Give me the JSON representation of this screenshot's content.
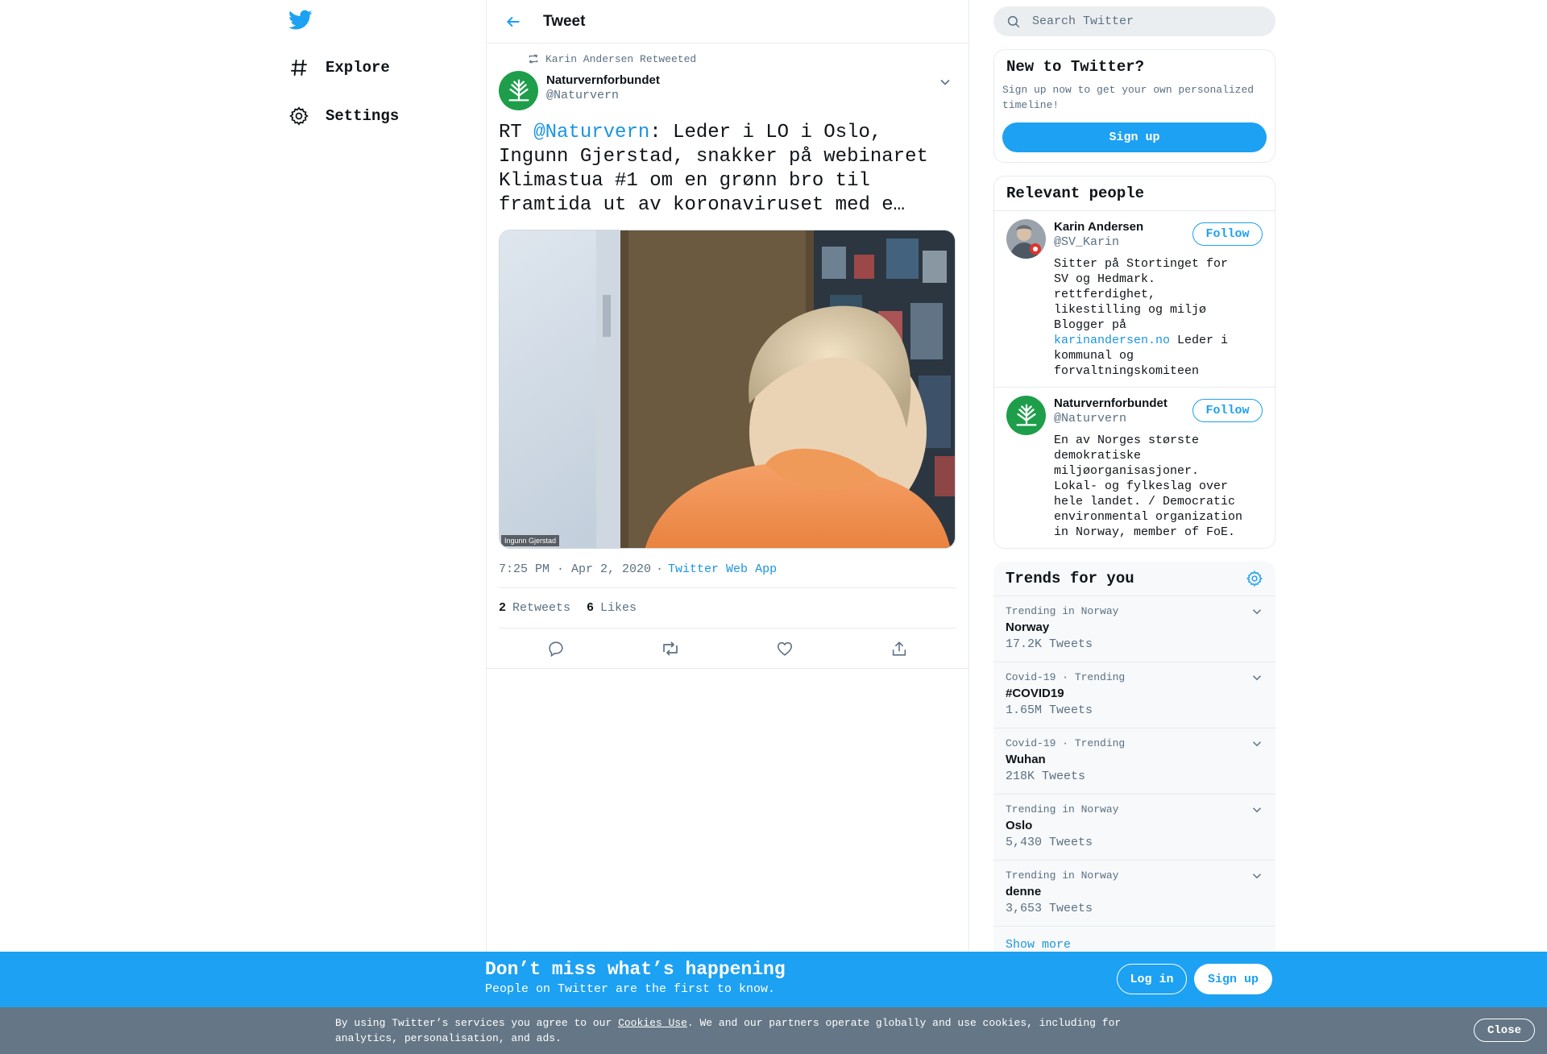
{
  "nav": {
    "logo_icon": "twitter-bird-icon",
    "items": [
      {
        "label": "Explore",
        "icon": "hashtag-icon"
      },
      {
        "label": "Settings",
        "icon": "gear-icon"
      }
    ]
  },
  "header": {
    "title": "Tweet",
    "back_icon": "arrow-left-icon"
  },
  "tweet": {
    "retweeted_by": "Karin Andersen Retweeted",
    "author_name": "Naturvernforbundet",
    "author_handle": "@Naturvern",
    "text_prefix": "RT ",
    "mention": "@Naturvern",
    "text_rest": ": Leder i LO i Oslo, Ingunn Gjerstad, snakker på webinaret Klimastua #1 om en grønn bro til framtida ut av koronaviruset med e…",
    "media_caption": "Ingunn Gjerstad",
    "timestamp": "7:25 PM · Apr 2, 2020",
    "separator": "·",
    "source": "Twitter Web App",
    "retweets_count": "2",
    "retweets_label": "Retweets",
    "likes_count": "6",
    "likes_label": "Likes"
  },
  "search": {
    "placeholder": "Search Twitter"
  },
  "new_to_twitter": {
    "title": "New to Twitter?",
    "subtitle": "Sign up now to get your own personalized timeline!",
    "signup_label": "Sign up"
  },
  "relevant": {
    "title": "Relevant people",
    "people": [
      {
        "name": "Karin Andersen",
        "handle": "@SV_Karin",
        "follow_label": "Follow",
        "bio_before": "Sitter på Stortinget for SV og Hedmark. rettferdighet, likestilling og miljø Blogger på ",
        "bio_link": "karinandersen.no",
        "bio_after": " Leder i kommunal og forvaltningskomiteen"
      },
      {
        "name": "Naturvernforbundet",
        "handle": "@Naturvern",
        "follow_label": "Follow",
        "bio_before": "En av Norges største demokratiske miljøorganisasjoner. Lokal- og fylkeslag over hele landet. / Democratic environmental organization in Norway, member of FoE.",
        "bio_link": "",
        "bio_after": ""
      }
    ]
  },
  "trends": {
    "title": "Trends for you",
    "items": [
      {
        "context": "Trending in Norway",
        "name": "Norway",
        "count": "17.2K Tweets"
      },
      {
        "context": "Covid-19 · Trending",
        "name": "#COVID19",
        "count": "1.65M Tweets"
      },
      {
        "context": "Covid-19 · Trending",
        "name": "Wuhan",
        "count": "218K Tweets"
      },
      {
        "context": "Trending in Norway",
        "name": "Oslo",
        "count": "5,430 Tweets"
      },
      {
        "context": "Trending in Norway",
        "name": "denne",
        "count": "3,653 Tweets"
      }
    ],
    "show_more": "Show more"
  },
  "bottom_bar": {
    "title": "Don’t miss what’s happening",
    "subtitle": "People on Twitter are the first to know.",
    "login_label": "Log in",
    "signup_label": "Sign up"
  },
  "cookie_bar": {
    "text_before": "By using Twitter’s services you agree to our ",
    "link": "Cookies Use",
    "text_after": ". We and our partners operate globally and use cookies, including for analytics, personalisation, and ads.",
    "close_label": "Close"
  },
  "colors": {
    "accent": "#1da1f2",
    "link": "#1b95e0",
    "cookie_bg": "#657786",
    "brand_green": "#1e9e4a"
  }
}
